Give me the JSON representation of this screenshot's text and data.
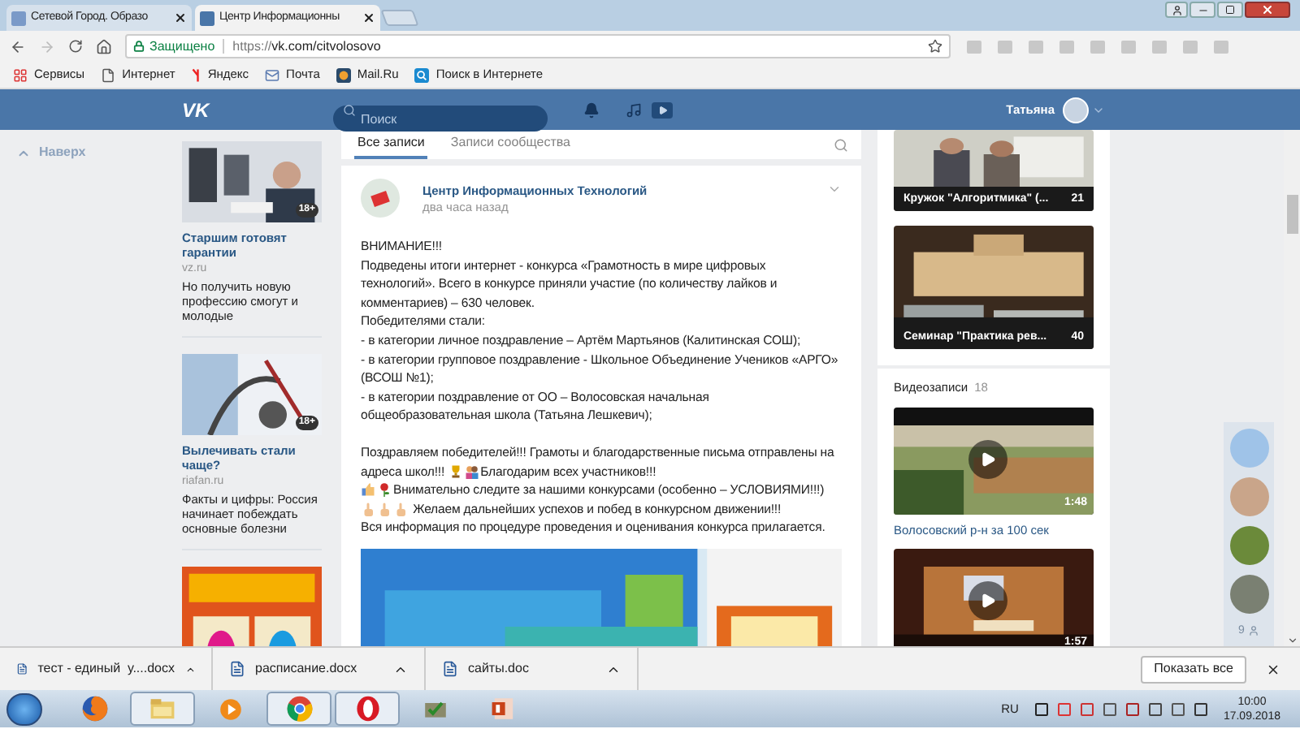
{
  "browser": {
    "tabs": [
      {
        "title": "Сетевой Город. Образо",
        "selected": false
      },
      {
        "title": "Центр Информационны",
        "selected": true
      }
    ],
    "address": {
      "secure_label": "Защищено",
      "scheme": "https://",
      "url": "vk.com/citvolosovo"
    },
    "bookmarks": [
      {
        "label": "Сервисы",
        "kind": "apps"
      },
      {
        "label": "Интернет",
        "kind": "page"
      },
      {
        "label": "Яндекс",
        "kind": "yandex"
      },
      {
        "label": "Почта",
        "kind": "mail"
      },
      {
        "label": "Mail.Ru",
        "kind": "mailru"
      },
      {
        "label": "Поиск в Интернете",
        "kind": "search"
      }
    ]
  },
  "vk": {
    "logo": "VK",
    "search": {
      "placeholder": "Поиск"
    },
    "user_name": "Татьяна",
    "back_to_top": "Наверх",
    "ads": [
      {
        "kind": "office",
        "age": "18+",
        "title": "Старшим готовят гарантии",
        "domain": "vz.ru",
        "text": "Но получить новую профессию смогут и молодые"
      },
      {
        "kind": "medical",
        "age": "18+",
        "title": "Вылечивать стали чаще?",
        "domain": "riafan.ru",
        "text": "Факты и цифры: Россия начинает побеждать основные болезни"
      },
      {
        "kind": "game"
      }
    ],
    "wall_tabs": [
      {
        "label": "Все записи",
        "selected": true
      },
      {
        "label": "Записи сообщества",
        "selected": false
      }
    ],
    "post": {
      "author": "Центр Информационных Технологий",
      "time": "два часа назад",
      "paragraphs": [
        [
          [
            {
              "kind": "text",
              "text": "ВНИМАНИЕ!!!"
            }
          ],
          [
            {
              "kind": "text",
              "text": "Подведены итоги интернет - конкурса «Грамотность в мире цифровых"
            }
          ],
          [
            {
              "kind": "text",
              "text": "технологий». Всего в конкурсе приняли участие (по количеству лайков и"
            }
          ],
          [
            {
              "kind": "text",
              "text": "комментариев) – 630 человек."
            }
          ],
          [
            {
              "kind": "text",
              "text": "Победителями стали:"
            }
          ],
          [
            {
              "kind": "text",
              "text": "- в категории личное поздравление – Артём Мартьянов (Калитинская СОШ);"
            }
          ],
          [
            {
              "kind": "text",
              "text": "- в категории групповое поздравление - Школьное Объединение Учеников «АРГО»"
            }
          ],
          [
            {
              "kind": "text",
              "text": "(ВСОШ №1);"
            }
          ],
          [
            {
              "kind": "text",
              "text": "- в категории поздравление от ОО – Волосовская начальная"
            }
          ],
          [
            {
              "kind": "text",
              "text": "общеобразовательная школа (Татьяна Лешкевич);"
            }
          ]
        ],
        [
          [
            {
              "kind": "text",
              "text": "Поздравляем победителей!!! Грамоты и благодарственные письма отправлены на"
            }
          ],
          [
            {
              "kind": "text",
              "text": "адреса школ!!! "
            },
            {
              "kind": "trophy"
            },
            {
              "kind": "people"
            },
            {
              "kind": "text",
              "text": "Благодарим всех участников!!!"
            }
          ],
          [
            {
              "kind": "thumb"
            },
            {
              "kind": "rose"
            },
            {
              "kind": "text",
              "text": "Внимательно следите за нашими конкурсами (особенно – УСЛОВИЯМИ!!!)"
            }
          ],
          [
            {
              "kind": "hand"
            },
            {
              "kind": "hand"
            },
            {
              "kind": "hand"
            },
            {
              "kind": "text",
              "text": " Желаем дальнейших успехов и побед в конкурсном движении!!!"
            }
          ],
          [
            {
              "kind": "text",
              "text": "Вся информация по процедуре проведения и оценивания конкурса прилагается."
            }
          ]
        ]
      ]
    },
    "albums": [
      {
        "kind": "classroom",
        "title": "Кружок \"Алгоритмика\" (...",
        "count": "21"
      },
      {
        "kind": "model",
        "title": "Семинар \"Практика рев...",
        "count": "40"
      }
    ],
    "videos": {
      "label": "Видеозаписи",
      "count": "18",
      "items": [
        {
          "kind": "town",
          "duration": "1:48",
          "title": "Волосовский р-н за 100 сек"
        },
        {
          "kind": "stage",
          "duration": "1:57"
        }
      ]
    },
    "online": {
      "count": "9"
    }
  },
  "downloads": {
    "items": [
      {
        "name": "тест - единый  у....docx"
      },
      {
        "name": "расписание.docx"
      },
      {
        "name": "сайты.doc"
      }
    ],
    "show_all": "Показать все"
  },
  "taskbar": {
    "apps": [
      {
        "kind": "firefox",
        "selected": false
      },
      {
        "kind": "explorer",
        "selected": true
      },
      {
        "kind": "media",
        "selected": false
      },
      {
        "kind": "chrome",
        "selected": true
      },
      {
        "kind": "opera",
        "selected": true
      },
      {
        "kind": "tick",
        "selected": false
      },
      {
        "kind": "powerpoint",
        "selected": false
      }
    ],
    "lang": "RU",
    "time": "10:00",
    "date": "17.09.2018"
  }
}
